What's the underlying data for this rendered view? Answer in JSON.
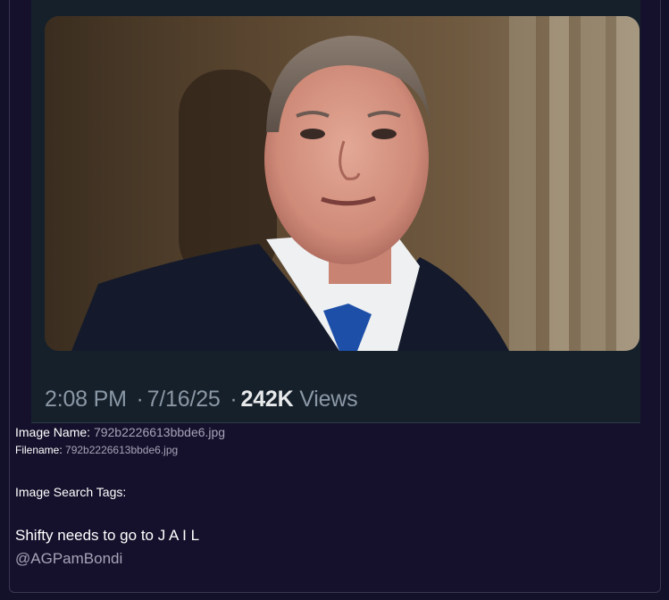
{
  "tweet": {
    "time": "2:08 PM",
    "separator": "·",
    "date": "7/16/25",
    "views_count": "242K",
    "views_label": "Views"
  },
  "image_info": {
    "name_label": "Image Name:",
    "name_value": "792b2226613bbde6.jpg",
    "filename_label": "Filename:",
    "filename_value": "792b2226613bbde6.jpg",
    "tags_label": "Image Search Tags:"
  },
  "post": {
    "caption": "Shifty needs to go to J A I L",
    "handle": "@AGPamBondi"
  },
  "colors": {
    "page_bg": "#13102a",
    "tweet_bg": "#15202b",
    "muted_text": "#8b98a5",
    "accent_tie": "#1e4fa8"
  }
}
